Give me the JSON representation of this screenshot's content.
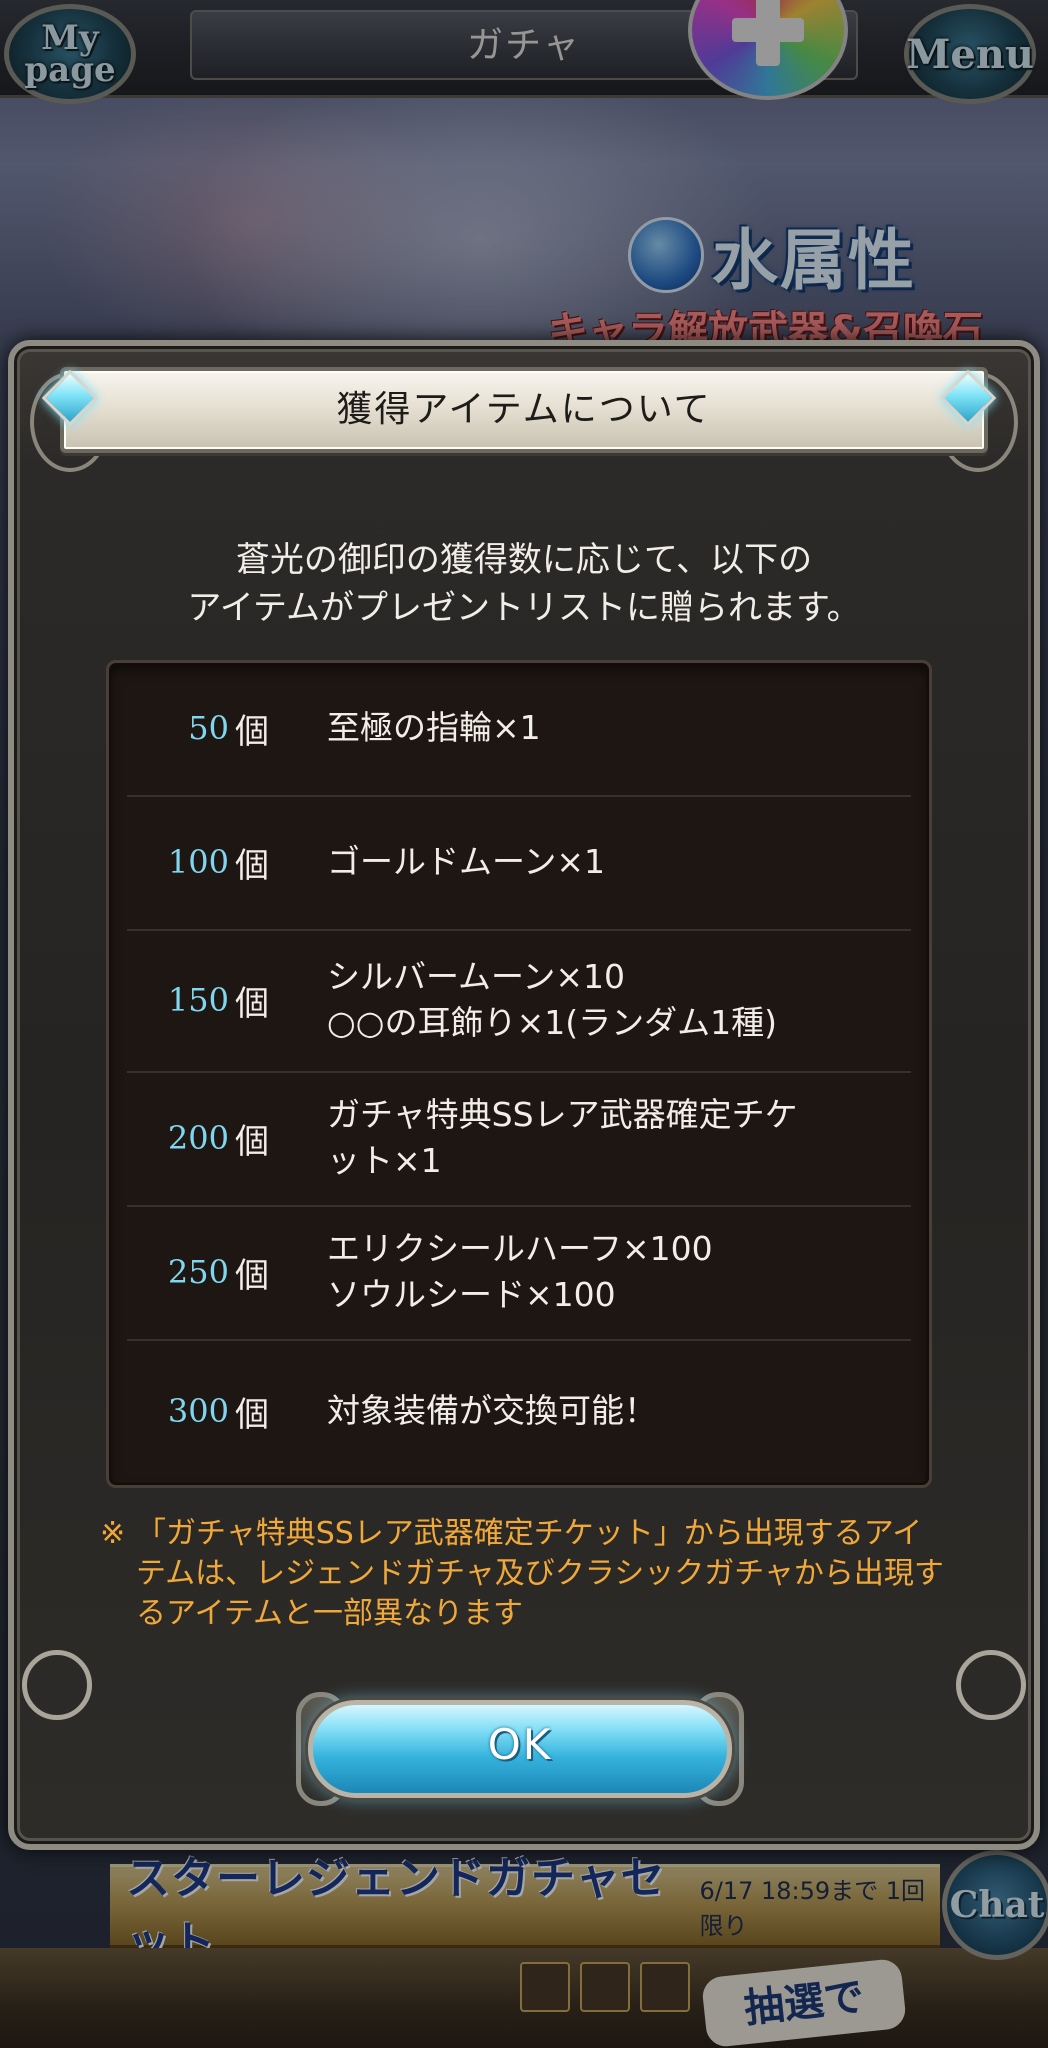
{
  "header": {
    "title": "ガチャ",
    "mypage_label_1": "My",
    "mypage_label_2": "page",
    "menu_label": "Menu"
  },
  "banner": {
    "element": "水属性",
    "subtitle": "キャラ解放武器&召喚石"
  },
  "modal": {
    "title": "獲得アイテムについて",
    "intro_line1": "蒼光の御印の獲得数に応じて、以下の",
    "intro_line2": "アイテムがプレゼントリストに贈られます。",
    "unit": "個",
    "rows": [
      {
        "count": "50",
        "reward_line1": "至極の指輪×1",
        "reward_line2": ""
      },
      {
        "count": "100",
        "reward_line1": "ゴールドムーン×1",
        "reward_line2": ""
      },
      {
        "count": "150",
        "reward_line1": "シルバームーン×10",
        "reward_line2": "○○の耳飾り×1(ランダム1種)"
      },
      {
        "count": "200",
        "reward_line1": "ガチャ特典SSレア武器確定チケ",
        "reward_line2": "ット×1"
      },
      {
        "count": "250",
        "reward_line1": "エリクシールハーフ×100",
        "reward_line2": "ソウルシード×100"
      },
      {
        "count": "300",
        "reward_line1": "対象装備が交換可能！",
        "reward_line2": ""
      }
    ],
    "note_mark": "※",
    "note_text": "「ガチャ特典SSレア武器確定チケット」から出現するアイテムは、レジェンドガチャ及びクラシックガチャから出現するアイテムと一部異なります",
    "ok_label": "OK"
  },
  "footer": {
    "banner_title": "スターレジェンドガチャセット",
    "banner_sub": "6/17 18:59まで 1回限り",
    "get_badge": "抽選でGET!",
    "chat_label": "Chat"
  },
  "colors": {
    "count_accent": "#7fd6ee",
    "note_orange": "#f0a83a",
    "ok_button": "#34b2dc"
  }
}
